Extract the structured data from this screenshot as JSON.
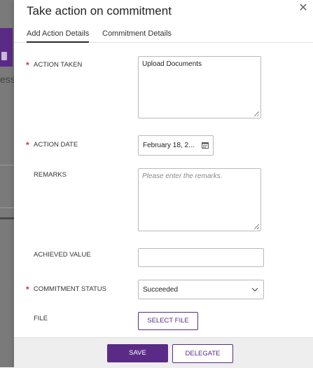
{
  "background": {
    "partial_text": "ess"
  },
  "drawer": {
    "title": "Take action on commitment",
    "close_icon": "close-icon"
  },
  "tabs": [
    {
      "label": "Add Action Details",
      "active": true
    },
    {
      "label": "Commitment Details",
      "active": false
    }
  ],
  "form": {
    "action_taken": {
      "label": "ACTION TAKEN",
      "required": true,
      "value": "Upload Documents"
    },
    "action_date": {
      "label": "ACTION DATE",
      "required": true,
      "value": "February 18, 2...",
      "icon": "calendar-icon"
    },
    "remarks": {
      "label": "REMARKS",
      "required": false,
      "value": "",
      "placeholder": "Please enter the remarks."
    },
    "achieved_value": {
      "label": "ACHIEVED VALUE",
      "required": false,
      "value": ""
    },
    "commitment_status": {
      "label": "COMMITMENT STATUS",
      "required": true,
      "value": "Succeeded",
      "icon": "chevron-down-icon"
    },
    "file": {
      "label": "FILE",
      "button_label": "SELECT FILE"
    }
  },
  "footer": {
    "save_label": "SAVE",
    "delegate_label": "DELEGATE"
  },
  "colors": {
    "accent": "#5b2a86",
    "required": "#d32f2f",
    "footer_bg": "#eeeeee"
  },
  "required_marker": "*"
}
